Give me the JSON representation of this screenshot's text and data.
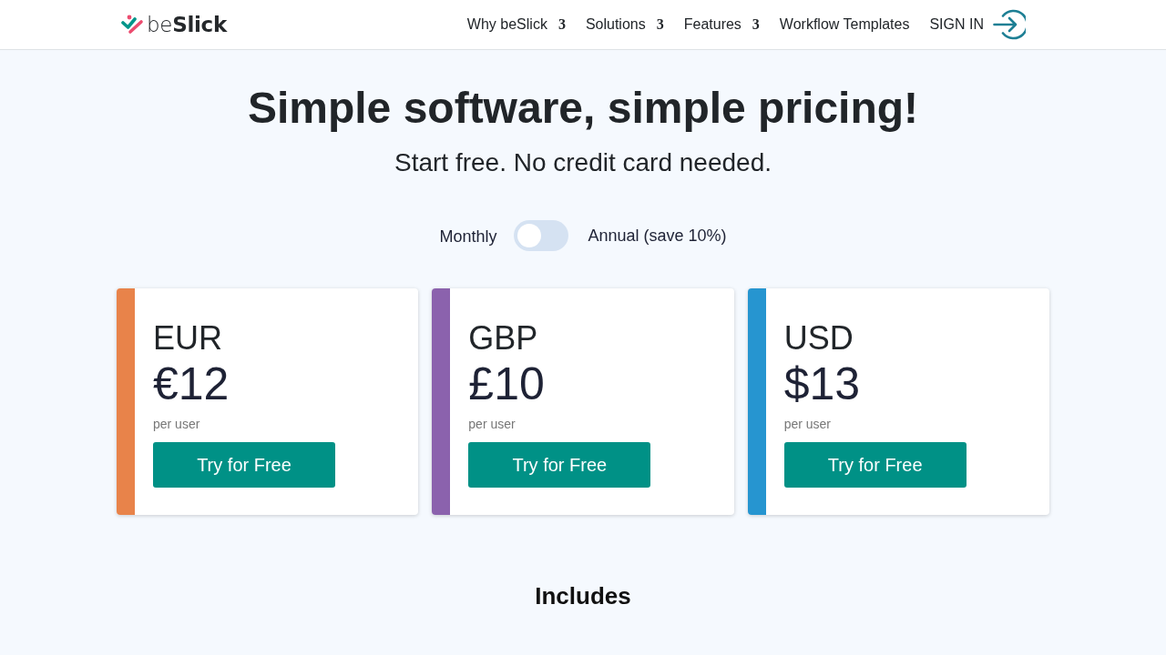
{
  "header": {
    "logo": {
      "text": "be**Slick**"
    },
    "nav": [
      {
        "label": "Why beSlick",
        "caret": "3"
      },
      {
        "label": "Solutions",
        "caret": "3"
      },
      {
        "label": "Features",
        "caret": "3"
      },
      {
        "label": "Workflow Templates"
      }
    ],
    "sign_in": {
      "label": "SIGN IN"
    }
  },
  "hero": {
    "title": "Simple software, simple pricing!",
    "subtitle": "Start free. No credit card needed."
  },
  "billing_toggle": {
    "left_label": "Monthly",
    "right_label": "Annual (save 10%)",
    "on": false
  },
  "plans": [
    {
      "currency": "EUR",
      "price": "€12",
      "unit": "per user",
      "button": "Try for Free",
      "color": "#e8834a"
    },
    {
      "currency": "GBP",
      "price": "£10",
      "unit": "per user",
      "button": "Try for Free",
      "color": "#8b62ad"
    },
    {
      "currency": "USD",
      "price": "$13",
      "unit": "per user",
      "button": "Try for Free",
      "color": "#2695d0"
    }
  ],
  "includes": {
    "title": "Includes"
  }
}
